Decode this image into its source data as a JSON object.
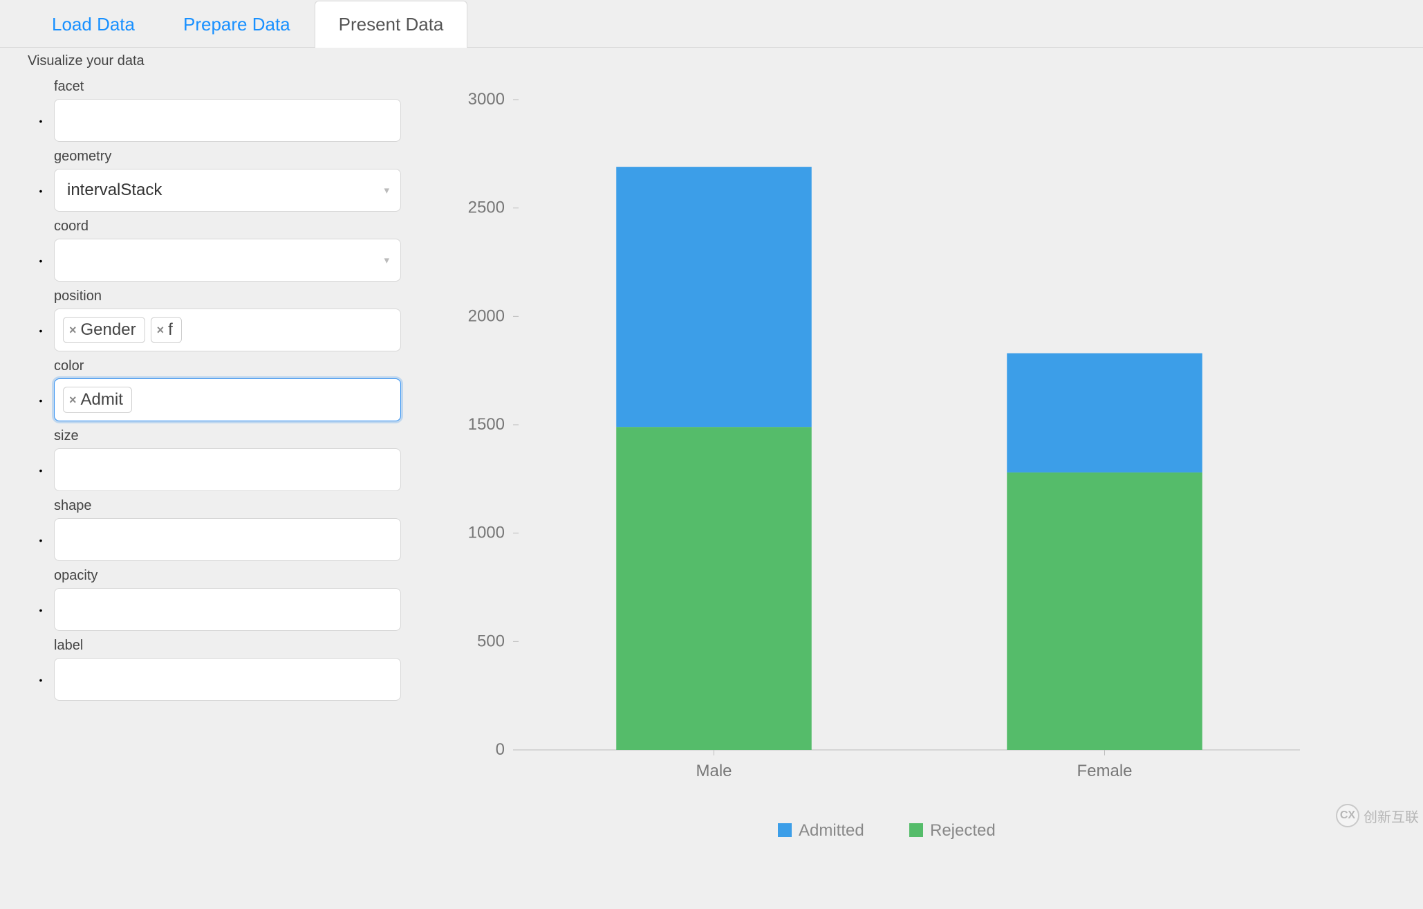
{
  "tabs": [
    {
      "label": "Load Data",
      "active": false
    },
    {
      "label": "Prepare Data",
      "active": false
    },
    {
      "label": "Present Data",
      "active": true
    }
  ],
  "subtitle": "Visualize your data",
  "fields": {
    "facet": {
      "label": "facet",
      "type": "tags",
      "value": []
    },
    "geometry": {
      "label": "geometry",
      "type": "select",
      "value": "intervalStack"
    },
    "coord": {
      "label": "coord",
      "type": "select",
      "value": ""
    },
    "position": {
      "label": "position",
      "type": "tags",
      "value": [
        "Gender",
        "f"
      ]
    },
    "color": {
      "label": "color",
      "type": "tags",
      "value": [
        "Admit"
      ],
      "focused": true
    },
    "size": {
      "label": "size",
      "type": "tags",
      "value": []
    },
    "shape": {
      "label": "shape",
      "type": "tags",
      "value": []
    },
    "opacity": {
      "label": "opacity",
      "type": "tags",
      "value": []
    },
    "label": {
      "label": "label",
      "type": "tags",
      "value": []
    }
  },
  "field_order": [
    "facet",
    "geometry",
    "coord",
    "position",
    "color",
    "size",
    "shape",
    "opacity",
    "label"
  ],
  "legend": [
    {
      "name": "Admitted",
      "color": "#3c9ee8"
    },
    {
      "name": "Rejected",
      "color": "#55bc6a"
    }
  ],
  "chart_data": {
    "type": "bar",
    "stacked": true,
    "categories": [
      "Male",
      "Female"
    ],
    "series": [
      {
        "name": "Admitted",
        "color": "#3c9ee8",
        "values": [
          1200,
          550
        ]
      },
      {
        "name": "Rejected",
        "color": "#55bc6a",
        "values": [
          1490,
          1280
        ]
      }
    ],
    "xlabel": "",
    "ylabel": "",
    "ylim": [
      0,
      3000
    ],
    "yticks": [
      0,
      500,
      1000,
      1500,
      2000,
      2500,
      3000
    ],
    "title": ""
  },
  "watermark": {
    "logo_text": "CX",
    "text": "创新互联"
  }
}
